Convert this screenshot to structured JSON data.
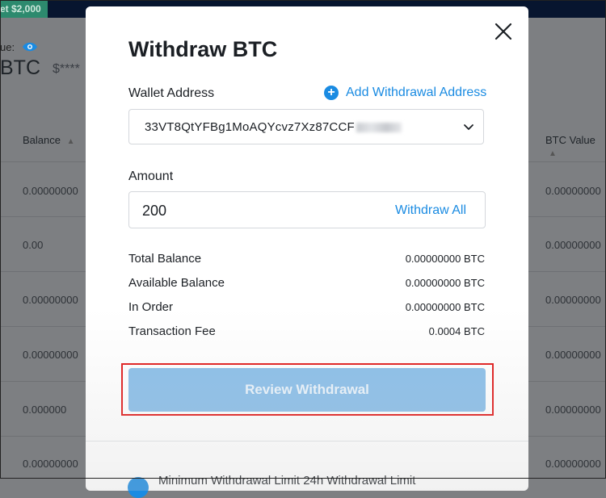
{
  "background": {
    "promo_text": "et $2,000",
    "value_label": "ue:",
    "balance_big": "BTC",
    "balance_masked": "$****",
    "columns": {
      "balance": "Balance",
      "btc_value": "BTC Value"
    },
    "rows": [
      {
        "balance": "0.00000000",
        "btc_value": "0.00000000"
      },
      {
        "balance": "0.00",
        "btc_value": "0.00000000"
      },
      {
        "balance": "0.00000000",
        "btc_value": "0.00000000"
      },
      {
        "balance": "0.00000000",
        "btc_value": "0.00000000"
      },
      {
        "balance": "0.000000",
        "btc_value": "0.00000000"
      },
      {
        "balance": "0.00000000",
        "btc_value": "0.00000000"
      }
    ]
  },
  "modal": {
    "title": "Withdraw BTC",
    "wallet_label": "Wallet Address",
    "add_address_label": "Add Withdrawal Address",
    "wallet_address": "33VT8QtYFBg1MoAQYcvz7Xz87CCF",
    "amount_label": "Amount",
    "amount_value": "200",
    "withdraw_all_label": "Withdraw All",
    "summary": [
      {
        "label": "Total Balance",
        "value": "0.00000000 BTC"
      },
      {
        "label": "Available Balance",
        "value": "0.00000000 BTC"
      },
      {
        "label": "In Order",
        "value": "0.00000000 BTC"
      },
      {
        "label": "Transaction Fee",
        "value": "0.0004 BTC"
      }
    ],
    "review_button": "Review Withdrawal",
    "limits_text": "Minimum Withdrawal Limit      24h Withdrawal Limit"
  },
  "colors": {
    "accent": "#1a8be2",
    "highlight": "#e11b1b",
    "button_disabled": "#8bbfe9"
  }
}
